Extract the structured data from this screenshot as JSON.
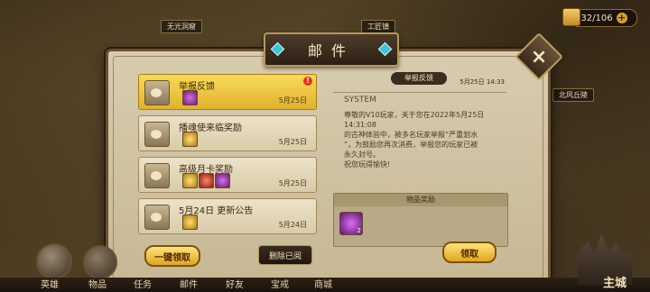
{
  "map": {
    "locations": [
      "无光洞窟",
      "工匠镇",
      "北风丘陵"
    ]
  },
  "resource": {
    "value": "32/106",
    "plus": "+"
  },
  "mail_panel": {
    "title": "邮件",
    "close": "×",
    "items": [
      {
        "title": "举报反馈",
        "date": "5月25日",
        "selected": true,
        "has_badge": true,
        "badge": "!"
      },
      {
        "title": "播魂使来临奖励",
        "date": "5月25日",
        "selected": false
      },
      {
        "title": "高级月卡奖励",
        "date": "5月25日",
        "selected": false
      },
      {
        "title": "5月24日 更新公告",
        "date": "5月24日",
        "selected": false
      }
    ],
    "claim_all_label": "一键领取",
    "delete_read_label": "删除已阅"
  },
  "detail": {
    "tag": "举报反馈",
    "date": "5月25日 14:33",
    "sender": "SYSTEM",
    "body": "尊敬的V10玩家，关于您在2022年5月25日\n14:31:08\n的古神体验中，被多名玩家举报“严重划水\n”，为鼓励您再次消费，举报您的玩家已被\n永久封号。\n祝您玩得愉快!",
    "rewards_header": "物品奖励",
    "reward_count": "2",
    "claim_label": "领取"
  },
  "bottom_nav": [
    "英雄",
    "物品",
    "任务",
    "邮件",
    "好友",
    "宝戒",
    "商城"
  ],
  "castle_label": "主城"
}
